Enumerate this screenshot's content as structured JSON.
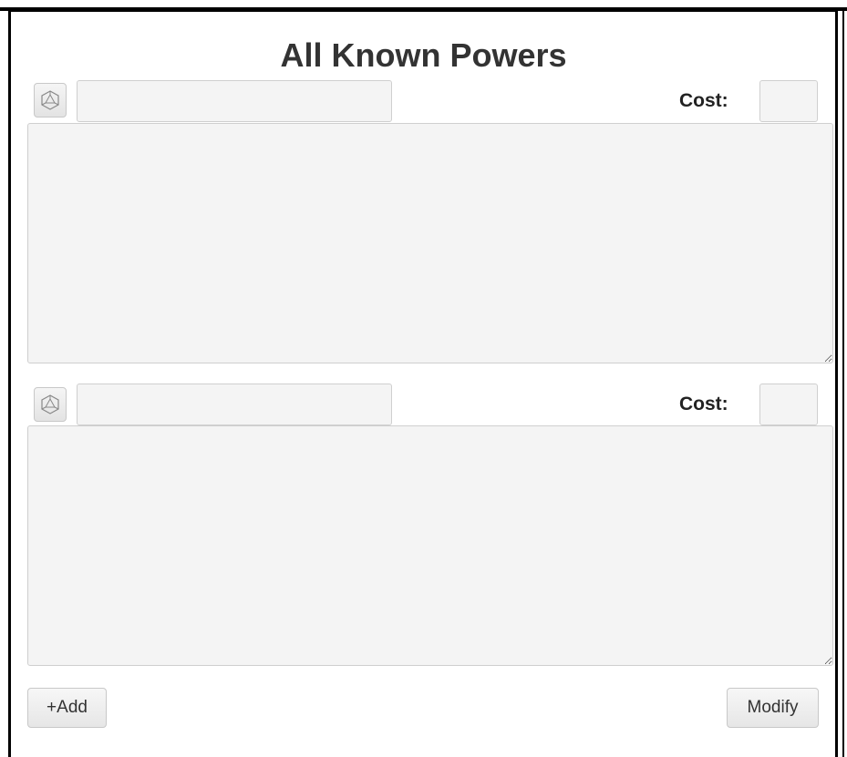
{
  "page": {
    "title": "All Known Powers"
  },
  "powers": [
    {
      "name": "",
      "cost_label": "Cost:",
      "cost": "",
      "description": "",
      "dice_icon": "d20-dice-icon"
    },
    {
      "name": "",
      "cost_label": "Cost:",
      "cost": "",
      "description": "",
      "dice_icon": "d20-dice-icon"
    }
  ],
  "actions": {
    "add_label": "+Add",
    "modify_label": "Modify"
  }
}
